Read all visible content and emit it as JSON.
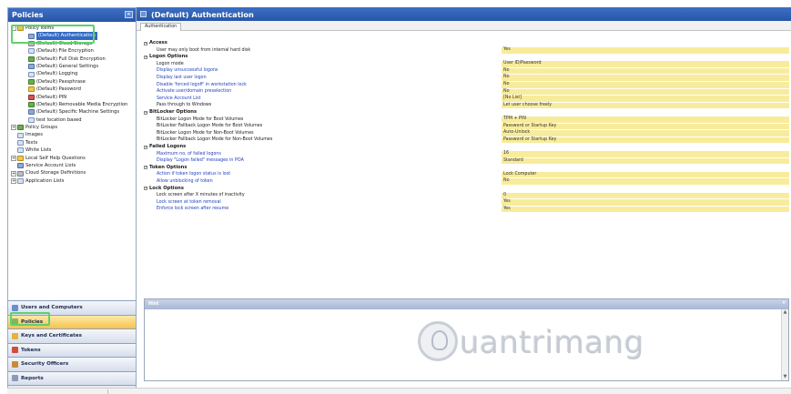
{
  "left_pane": {
    "title": "Policies",
    "collapse_glyph": "«"
  },
  "tree": [
    {
      "label": "Policy Items",
      "indent": 0,
      "expander": "-",
      "icon": "folder",
      "icon_name": "folder-icon"
    },
    {
      "label": "(Default) Authentication",
      "indent": 2,
      "icon": "shield",
      "icon_name": "authentication-icon",
      "selected": true
    },
    {
      "label": "(Default) Cloud Storage",
      "indent": 2,
      "icon": "gray",
      "icon_name": "cloud-storage-icon"
    },
    {
      "label": "(Default) File Encryption",
      "indent": 2,
      "icon": "doc",
      "icon_name": "file-encryption-icon"
    },
    {
      "label": "(Default) Full Disk Encryption",
      "indent": 2,
      "icon": "green",
      "icon_name": "full-disk-encryption-icon"
    },
    {
      "label": "(Default) General Settings",
      "indent": 2,
      "icon": "shield",
      "icon_name": "general-settings-icon"
    },
    {
      "label": "(Default) Logging",
      "indent": 2,
      "icon": "doc",
      "icon_name": "logging-icon"
    },
    {
      "label": "(Default) Passphrase",
      "indent": 2,
      "icon": "green",
      "icon_name": "passphrase-icon"
    },
    {
      "label": "(Default) Password",
      "indent": 2,
      "icon": "yellow",
      "icon_name": "password-icon"
    },
    {
      "label": "(Default) PIN",
      "indent": 2,
      "icon": "red",
      "icon_name": "pin-icon"
    },
    {
      "label": "(Default) Removable Media Encryption",
      "indent": 2,
      "icon": "green",
      "icon_name": "removable-media-icon"
    },
    {
      "label": "(Default) Specific Machine Settings",
      "indent": 2,
      "icon": "shield",
      "icon_name": "machine-settings-icon"
    },
    {
      "label": "test location based",
      "indent": 2,
      "icon": "doc",
      "icon_name": "policy-icon"
    },
    {
      "label": "Policy Groups",
      "indent": 0,
      "expander": "+",
      "icon": "green",
      "icon_name": "policy-groups-icon"
    },
    {
      "label": "Images",
      "indent": 0,
      "icon": "doc",
      "icon_name": "images-icon"
    },
    {
      "label": "Texts",
      "indent": 0,
      "icon": "doc",
      "icon_name": "texts-icon"
    },
    {
      "label": "White Lists",
      "indent": 0,
      "icon": "doc",
      "icon_name": "white-lists-icon"
    },
    {
      "label": "Local Self Help Questions",
      "indent": 0,
      "expander": "+",
      "icon": "yellow",
      "icon_name": "help-questions-icon"
    },
    {
      "label": "Service Account Lists",
      "indent": 0,
      "icon": "shield",
      "icon_name": "service-account-icon"
    },
    {
      "label": "Cloud Storage Definitions",
      "indent": 0,
      "expander": "+",
      "icon": "gray",
      "icon_name": "cloud-definitions-icon"
    },
    {
      "label": "Application Lists",
      "indent": 0,
      "expander": "+",
      "icon": "doc",
      "icon_name": "application-lists-icon"
    }
  ],
  "nav": [
    {
      "label": "Users and Computers",
      "icon": "#6a8fd0",
      "icon_name": "users-computers-icon"
    },
    {
      "label": "Policies",
      "icon": "#7fb85a",
      "icon_name": "policies-icon",
      "active": true
    },
    {
      "label": "Keys and Certificates",
      "icon": "#e4b43a",
      "icon_name": "keys-icon"
    },
    {
      "label": "Tokens",
      "icon": "#d24b3f",
      "icon_name": "tokens-icon"
    },
    {
      "label": "Security Officers",
      "icon": "#c98a3a",
      "icon_name": "security-officers-icon"
    },
    {
      "label": "Reports",
      "icon": "#8a9bb8",
      "icon_name": "reports-icon"
    }
  ],
  "nav_footer_glyph": "»",
  "right_pane": {
    "title": "(Default) Authentication",
    "tab_label": "Authentication"
  },
  "properties": [
    {
      "type": "cat",
      "label": "Access"
    },
    {
      "type": "row",
      "name": "User may only boot from internal hard disk",
      "value": "Yes",
      "blue": false
    },
    {
      "type": "cat",
      "label": "Logon Options"
    },
    {
      "type": "row",
      "name": "Logon mode",
      "value": "User ID/Password",
      "blue": false
    },
    {
      "type": "row",
      "name": "Display unsuccessful logons",
      "value": "No",
      "blue": true
    },
    {
      "type": "row",
      "name": "Display last user logon",
      "value": "No",
      "blue": true
    },
    {
      "type": "row",
      "name": "Disable 'forced logoff' in workstation lock",
      "value": "No",
      "blue": true
    },
    {
      "type": "row",
      "name": "Activate user/domain preselection",
      "value": "No",
      "blue": true
    },
    {
      "type": "row",
      "name": "Service Account List",
      "value": "[No List]",
      "blue": true
    },
    {
      "type": "row",
      "name": "Pass through to Windows",
      "value": "Let user choose freely",
      "blue": false
    },
    {
      "type": "cat",
      "label": "BitLocker Options"
    },
    {
      "type": "row",
      "name": "BitLocker Logon Mode for Boot Volumes",
      "value": "TPM + PIN",
      "blue": false
    },
    {
      "type": "row",
      "name": "BitLocker Fallback Logon Mode for Boot Volumes",
      "value": "Password or Startup Key",
      "blue": false
    },
    {
      "type": "row",
      "name": "BitLocker Logon Mode for Non-Boot Volumes",
      "value": "Auto-Unlock",
      "blue": false
    },
    {
      "type": "row",
      "name": "BitLocker Fallback Logon Mode for Non-Boot Volumes",
      "value": "Password or Startup Key",
      "blue": false
    },
    {
      "type": "cat",
      "label": "Failed Logons"
    },
    {
      "type": "row",
      "name": "Maximum no. of failed logons",
      "value": "16",
      "blue": true
    },
    {
      "type": "row",
      "name": "Display \"Logon failed\" messages in POA",
      "value": "Standard",
      "blue": true
    },
    {
      "type": "cat",
      "label": "Token Options"
    },
    {
      "type": "row",
      "name": "Action if token logon status is lost",
      "value": "Lock Computer",
      "blue": true
    },
    {
      "type": "row",
      "name": "Allow unblocking of token",
      "value": "No",
      "blue": true
    },
    {
      "type": "cat",
      "label": "Lock Options"
    },
    {
      "type": "row",
      "name": "Lock screen after X minutes of inactivity",
      "value": "0",
      "blue": false
    },
    {
      "type": "row",
      "name": "Lock screen at token removal",
      "value": "Yes",
      "blue": true
    },
    {
      "type": "row",
      "name": "Enforce lock screen after resume",
      "value": "Yes",
      "blue": true
    }
  ],
  "help": {
    "title": "Hint",
    "close_glyph": "×",
    "scroll_up": "▲",
    "scroll_down": "▼",
    "watermark": "uantrimang"
  }
}
